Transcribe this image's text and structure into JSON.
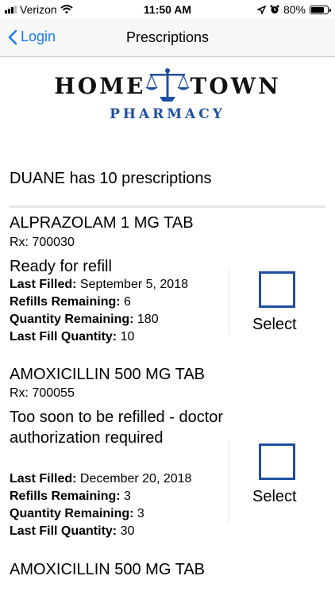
{
  "status_bar": {
    "carrier": "Verizon",
    "time": "11:50 AM",
    "battery": "80%",
    "battery_level": 0.8
  },
  "nav": {
    "back_label": "Login",
    "title": "Prescriptions"
  },
  "logo": {
    "line1_left": "HOME",
    "line1_right": "TOWN",
    "line2": "PHARMACY"
  },
  "summary": "DUANE has 10 prescriptions",
  "prescriptions": [
    {
      "name": "ALPRAZOLAM 1 MG TAB",
      "rx": "Rx: 700030",
      "status": "Ready for refill",
      "last_filled_label": "Last Filled:",
      "last_filled": "September 5, 2018",
      "refills_label": "Refills Remaining:",
      "refills": "6",
      "qty_remaining_label": "Quantity Remaining:",
      "qty_remaining": "180",
      "last_fill_qty_label": "Last Fill Quantity:",
      "last_fill_qty": "10",
      "select_label": "Select"
    },
    {
      "name": "AMOXICILLIN 500 MG TAB",
      "rx": "Rx: 700055",
      "status": "Too soon to be refilled - doctor authorization required",
      "last_filled_label": "Last Filled:",
      "last_filled": "December 20, 2018",
      "refills_label": "Refills Remaining:",
      "refills": "3",
      "qty_remaining_label": "Quantity Remaining:",
      "qty_remaining": "3",
      "last_fill_qty_label": "Last Fill Quantity:",
      "last_fill_qty": "30",
      "select_label": "Select"
    },
    {
      "name": "AMOXICILLIN 500 MG TAB"
    }
  ]
}
